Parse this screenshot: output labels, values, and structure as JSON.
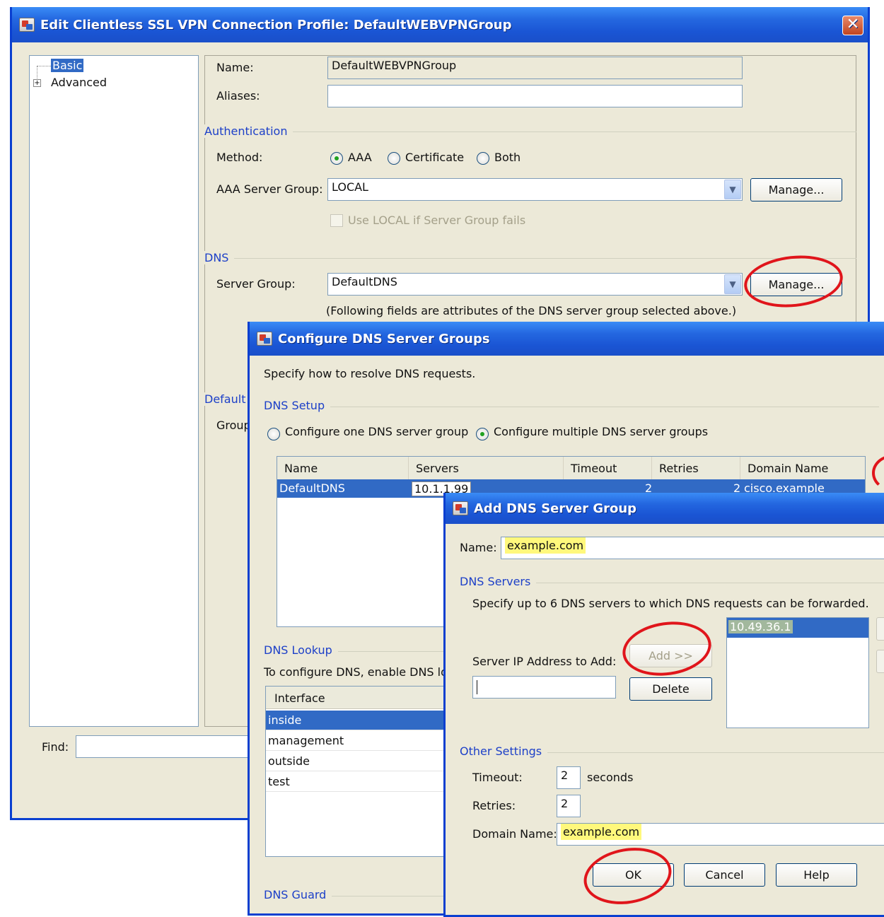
{
  "main": {
    "title": "Edit Clientless SSL VPN Connection Profile: DefaultWEBVPNGroup",
    "close_glyph": "✕",
    "tree": [
      {
        "label": "Basic",
        "selected": true
      },
      {
        "label": "Advanced",
        "expander": "+"
      }
    ],
    "find_label": "Find:",
    "name_label": "Name:",
    "name_value": "DefaultWEBVPNGroup",
    "aliases_label": "Aliases:",
    "aliases_value": "",
    "auth_title": "Authentication",
    "method_label": "Method:",
    "method_options": [
      "AAA",
      "Certificate",
      "Both"
    ],
    "method_selected": "AAA",
    "aaa_group_label": "AAA Server Group:",
    "aaa_group_value": "LOCAL",
    "manage_label": "Manage...",
    "use_local_label": "Use LOCAL if Server Group fails",
    "dns_title": "DNS",
    "server_group_label": "Server Group:",
    "server_group_value": "DefaultDNS",
    "dns_note": "(Following fields are attributes of the DNS server group selected above.)",
    "default_title_partial": "Default",
    "group_label_partial": "Group"
  },
  "configure": {
    "title": "Configure DNS Server Groups",
    "intro": "Specify how to resolve DNS requests.",
    "setup_title": "DNS Setup",
    "opt_one": "Configure one DNS server group",
    "opt_multiple": "Configure multiple DNS server groups",
    "selected_option": "multiple",
    "table_headers": [
      "Name",
      "Servers",
      "Timeout",
      "Retries",
      "Domain Name"
    ],
    "table_rows": [
      {
        "name": "DefaultDNS",
        "servers": "10.1.1.99",
        "timeout": "2",
        "retries": "2",
        "domain": "cisco.example"
      }
    ],
    "lookup_title": "DNS Lookup",
    "lookup_text": "To configure DNS, enable DNS lookup",
    "interface_header": "Interface",
    "interfaces": [
      {
        "label": "inside",
        "selected": true
      },
      {
        "label": "management",
        "selected": false
      },
      {
        "label": "outside",
        "selected": false
      },
      {
        "label": "test",
        "selected": false
      }
    ],
    "guard_title": "DNS Guard"
  },
  "add": {
    "title": "Add DNS Server Group",
    "name_label": "Name:",
    "name_value": "example.com",
    "servers_title": "DNS Servers",
    "servers_text": "Specify up to 6 DNS servers to which DNS requests can be forwarded.",
    "ip_label": "Server IP Address to Add:",
    "ip_value": "",
    "add_button": "Add >>",
    "delete_button": "Delete",
    "server_list": [
      "10.49.36.1"
    ],
    "other_title": "Other Settings",
    "timeout_label": "Timeout:",
    "timeout_value": "2",
    "timeout_unit": "seconds",
    "retries_label": "Retries:",
    "retries_value": "2",
    "domain_label": "Domain Name:",
    "domain_value": "example.com",
    "ok_button": "OK",
    "cancel_button": "Cancel",
    "help_button": "Help"
  },
  "colors": {
    "titlebar": "#1a55d4",
    "window_bg": "#ece9d8",
    "selection": "#316ac5",
    "highlight": "#fff87c",
    "annotation": "#e0151b",
    "section_title": "#1d40c8"
  }
}
